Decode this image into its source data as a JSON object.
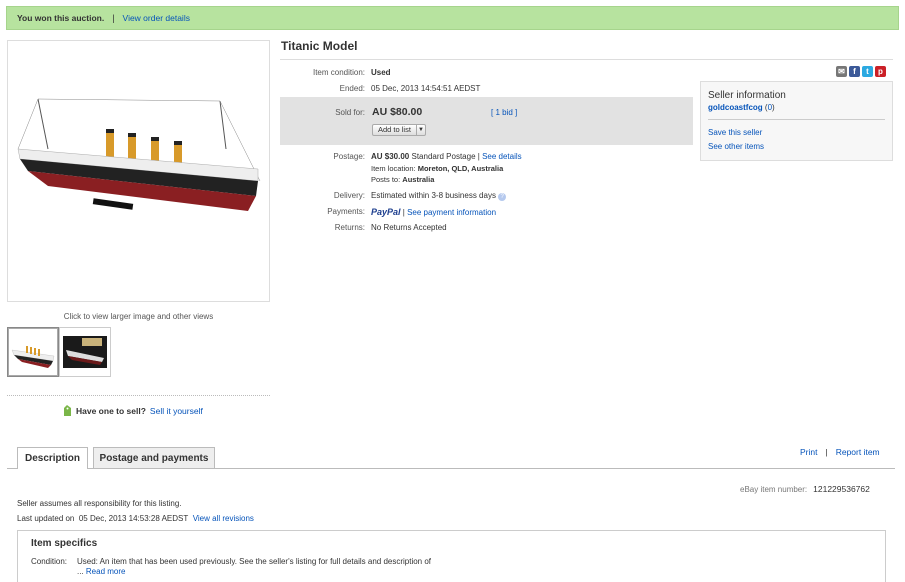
{
  "banner": {
    "won_text": "You won this auction.",
    "separator": "|",
    "view_order": "View order details"
  },
  "image": {
    "click_view": "Click to view larger image and other views"
  },
  "sell": {
    "question": "Have one to sell?",
    "link": "Sell it yourself"
  },
  "item": {
    "title": "Titanic Model",
    "condition_label": "Item condition:",
    "condition_value": "Used",
    "ended_label": "Ended:",
    "ended_value": "05 Dec, 2013  14:54:51 AEDST",
    "sold_label": "Sold for:",
    "price": "AU $80.00",
    "bids": "[ 1 bid ]",
    "add_to_list": "Add to list",
    "postage_label": "Postage:",
    "postage_price": "AU $30.00",
    "postage_type": "Standard Postage |",
    "see_details": "See details",
    "location_label": "Item location:",
    "location_value": "Moreton, QLD, Australia",
    "posts_label": "Posts to:",
    "posts_value": "Australia",
    "delivery_label": "Delivery:",
    "delivery_value": "Estimated within 3-8 business days",
    "payments_label": "Payments:",
    "paypal": "PayPal",
    "payment_sep": "|",
    "payment_info": "See payment information",
    "returns_label": "Returns:",
    "returns_value": "No Returns Accepted"
  },
  "seller": {
    "heading": "Seller information",
    "name": "goldcoastfcog",
    "feedback": "0",
    "save": "Save this seller",
    "other": "See other items"
  },
  "tabs": {
    "description": "Description",
    "postage": "Postage and payments"
  },
  "actions": {
    "print": "Print",
    "sep": "|",
    "report": "Report item"
  },
  "listing": {
    "item_number_label": "eBay item number:",
    "item_number": "121229536762",
    "responsibility": "Seller assumes all responsibility for this listing.",
    "last_updated_label": "Last updated on",
    "last_updated_value": "05 Dec, 2013 14:53:28 AEDST",
    "view_revisions": "View all revisions"
  },
  "specifics": {
    "heading": "Item specifics",
    "condition_label": "Condition:",
    "condition_text": "Used: An item that has been used previously. See the seller's listing for full details and description of ...",
    "read_more": "Read more"
  },
  "colors": {
    "banner": "#b7e39f",
    "link": "#0654ba",
    "sold_box": "#e2e2e2"
  }
}
